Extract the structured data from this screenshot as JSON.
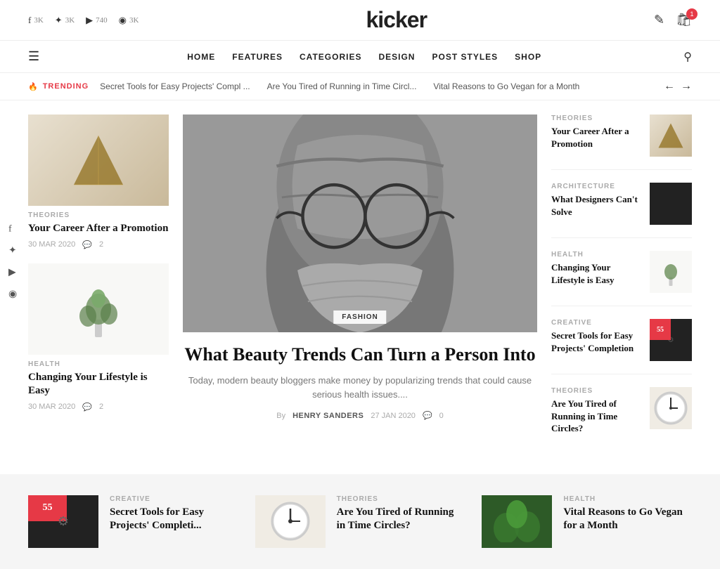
{
  "site": {
    "title": "kicker"
  },
  "topBar": {
    "socials": [
      {
        "icon": "f",
        "label": "facebook",
        "count": "3K"
      },
      {
        "icon": "t",
        "label": "twitter",
        "count": "3K"
      },
      {
        "icon": "▶",
        "label": "youtube",
        "count": "740"
      },
      {
        "icon": "◉",
        "label": "instagram",
        "count": "3K"
      }
    ],
    "cartCount": "1"
  },
  "nav": {
    "items": [
      {
        "label": "HOME"
      },
      {
        "label": "FEATURES"
      },
      {
        "label": "CATEGORIES"
      },
      {
        "label": "DESIGN"
      },
      {
        "label": "POST STYLES"
      },
      {
        "label": "SHOP"
      }
    ]
  },
  "trending": {
    "label": "TRENDING",
    "items": [
      "Secret Tools for Easy Projects' Compl ...",
      "Are You Tired of Running in Time Circl...",
      "Vital Reasons to Go Vegan for a Month"
    ]
  },
  "leftCards": [
    {
      "category": "THEORIES",
      "title": "Your Career After a Promotion",
      "date": "30 MAR 2020",
      "comments": "2"
    },
    {
      "category": "HEALTH",
      "title": "Changing Your Lifestyle is Easy",
      "date": "30 MAR 2020",
      "comments": "2"
    }
  ],
  "featuredArticle": {
    "category": "FASHION",
    "title": "What Beauty Trends Can Turn a Person Into",
    "excerpt": "Today, modern beauty bloggers make money by popularizing trends that could cause serious health issues....",
    "author": "HENRY SANDERS",
    "date": "27 JAN 2020",
    "comments": "0"
  },
  "rightCards": [
    {
      "category": "THEORIES",
      "title": "Your Career After a Promotion"
    },
    {
      "category": "ARCHITECTURE",
      "title": "What Designers Can't Solve"
    },
    {
      "category": "HEALTH",
      "title": "Changing Your Lifestyle is Easy"
    },
    {
      "category": "CREATIVE",
      "title": "Secret Tools for Easy Projects' Completion"
    },
    {
      "category": "THEORIES",
      "title": "Are You Tired of Running in Time Circles?"
    }
  ],
  "bottomCards": [
    {
      "category": "CREATIVE",
      "title": "Secret Tools for Easy Projects' Completi..."
    },
    {
      "category": "THEORIES",
      "title": "Are You Tired of Running in Time Circles?"
    },
    {
      "category": "HEALTH",
      "title": "Vital Reasons to Go Vegan for a Month"
    }
  ],
  "metaBy": "By",
  "metaCommentIcon": "💬"
}
